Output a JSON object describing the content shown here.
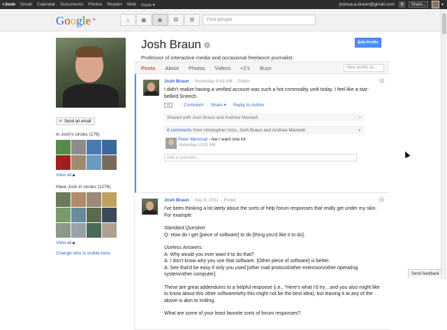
{
  "topbar": {
    "items": [
      "+Josh",
      "Gmail",
      "Calendar",
      "Documents",
      "Photos",
      "Reader",
      "Web",
      "more ▾"
    ],
    "email": "joshua.a.braun@gmail.com",
    "notification_count": "0",
    "share_label": "Share..."
  },
  "header": {
    "logo": {
      "g1": "G",
      "o1": "o",
      "o2": "o",
      "g2": "g",
      "l": "l",
      "e": "e",
      "plus": "+"
    },
    "nav_icons": [
      "home-icon",
      "photos-icon",
      "profile-icon",
      "circles-icon",
      "games-icon"
    ],
    "search_placeholder": "Find people"
  },
  "profile": {
    "name": "Josh Braun",
    "tagline": "Professor of interactive media and occasional freelance journalist.",
    "edit_label": "Edit Profile",
    "send_email_label": "Send an email",
    "in_circles_title": "In Josh's circles (176)",
    "have_in_circles_title": "Have Josh in circles (1276)",
    "view_all_label": "View all",
    "change_visible_label": "Change who is visible here",
    "in_circles_colors": [
      "#5a8a4a",
      "#8c8c8c",
      "#4a7ab0",
      "#3a6a9a",
      "#a02020",
      "#a08a70",
      "#6a9ac0",
      "#7a6a5a"
    ],
    "have_circles_colors": [
      "#6a7a5a",
      "#b08a6a",
      "#9a8a7a",
      "#c0a060",
      "#7a9a6a",
      "#6a8aa0",
      "#5a6a4a",
      "#3a4a5a",
      "#8a9a8a",
      "#9aa0a8",
      "#4a6a5a",
      "#b0a090"
    ]
  },
  "tabs": {
    "items": [
      "Posts",
      "About",
      "Photos",
      "Videos",
      "+1's",
      "Buzz"
    ],
    "active": "Posts",
    "view_as_placeholder": "View profile as..."
  },
  "posts": [
    {
      "author": "Josh Braun",
      "time": "Yesterday 9:43 AM",
      "visibility": "Public",
      "body": "I didn't realize having a verified account was such a hot commodity until today. I feel like a star-bellied Sneech.",
      "plus_one_label": "+1",
      "actions": [
        "Comment",
        "Share ▾",
        "Reply to Author"
      ],
      "shared_with": "Shared with Josh Braun and Andrew Maxwell",
      "comments_count": "6 comments",
      "comments_from": "from christopher rizzo, Josh Braun and Andrew Maxwell",
      "comment": {
        "author": "Peter Menocal",
        "text": "Aw I want one lol",
        "time": "Yesterday 10:02 AM"
      },
      "add_comment_placeholder": "Add a comment..."
    },
    {
      "author": "Josh Braun",
      "time": "Sep 9, 2011",
      "visibility": "Public",
      "intro": "I've been thinking a lot lately about the sorts of help forum responses that really get under my skin. For example:",
      "standard_label": "Standard Question:",
      "standard_q": "Q: How do I get [piece of software] to do [thing you'd like it to do].",
      "useless_label": "Useless Answers:",
      "answer1": "A: Why would you ever want it to do that?",
      "answer2": "A: I don't know why you use that software. [Other piece of software] is better.",
      "answer3": "A: See that'd be easy if only you used [other mail protocol/other extension/other operating system/other computer].",
      "addendum": "These are great addendums to a helpful response (i.e., \"Here's what I'd try…and you also might like to know about this other software/why this might not be the best idea), but leaving it at any of the above is akin to trolling.",
      "question": "What are some of your least favorite sorts of forum responses?"
    }
  ],
  "feedback_label": "Send feedback",
  "colors": {
    "accent_red": "#dd4b39",
    "link_blue": "#3366cc",
    "button_blue": "#4d90fe",
    "topbar": "#2d2d2d"
  }
}
